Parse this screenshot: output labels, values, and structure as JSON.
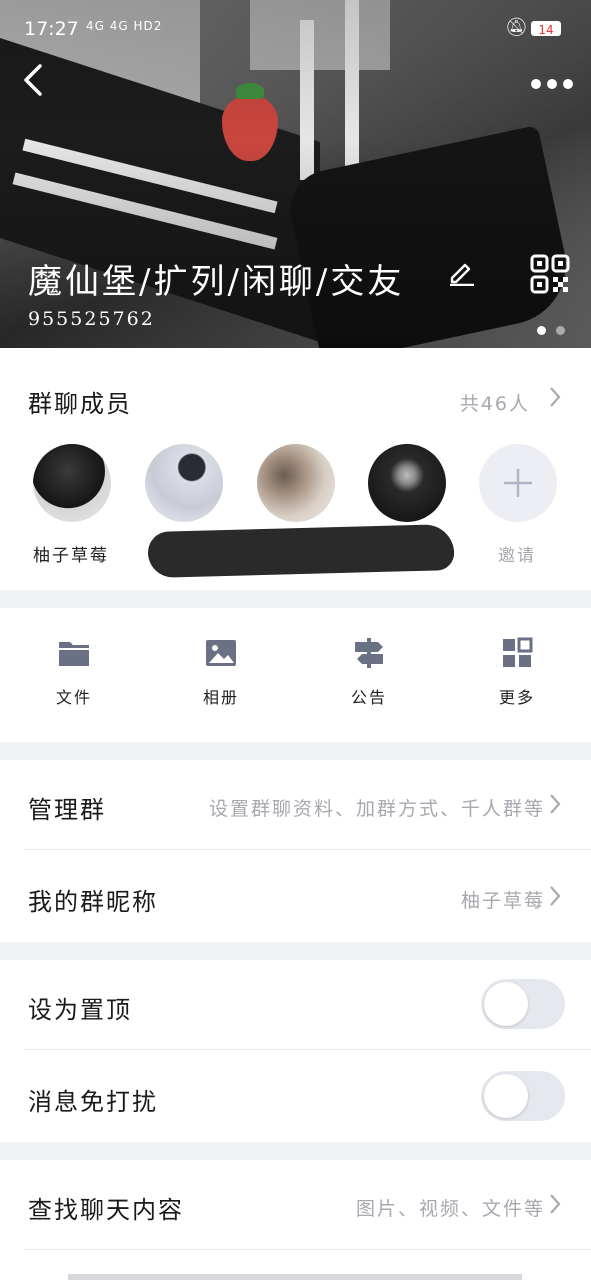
{
  "status_bar": {
    "time": "17:27",
    "signal": "4G  4G  HD2",
    "battery": "14"
  },
  "header": {
    "group_name": "魔仙堡/扩列/闲聊/交友",
    "group_id": "955525762",
    "more": "•••"
  },
  "members": {
    "title": "群聊成员",
    "count_label": "共46人",
    "first_member_name": "柚子草莓",
    "invite_label": "邀请",
    "invite_symbol": "+"
  },
  "tools": [
    {
      "label": "文件",
      "icon": "folder-icon"
    },
    {
      "label": "相册",
      "icon": "photo-icon"
    },
    {
      "label": "公告",
      "icon": "signpost-icon"
    },
    {
      "label": "更多",
      "icon": "grid-icon"
    }
  ],
  "manage": {
    "title": "管理群",
    "value": "设置群聊资料、加群方式、千人群等"
  },
  "nickname": {
    "title": "我的群昵称",
    "value": "柚子草莓"
  },
  "pin_top": {
    "title": "设为置顶",
    "enabled": false
  },
  "mute": {
    "title": "消息免打扰",
    "enabled": false
  },
  "search_history": {
    "title": "查找聊天内容",
    "value": "图片、视频、文件等"
  },
  "colors": {
    "background": "#f1f2f6",
    "secondary_text": "#a8a8b0",
    "icon": "#6b7184",
    "toggle_off": "#e6e8f0"
  }
}
